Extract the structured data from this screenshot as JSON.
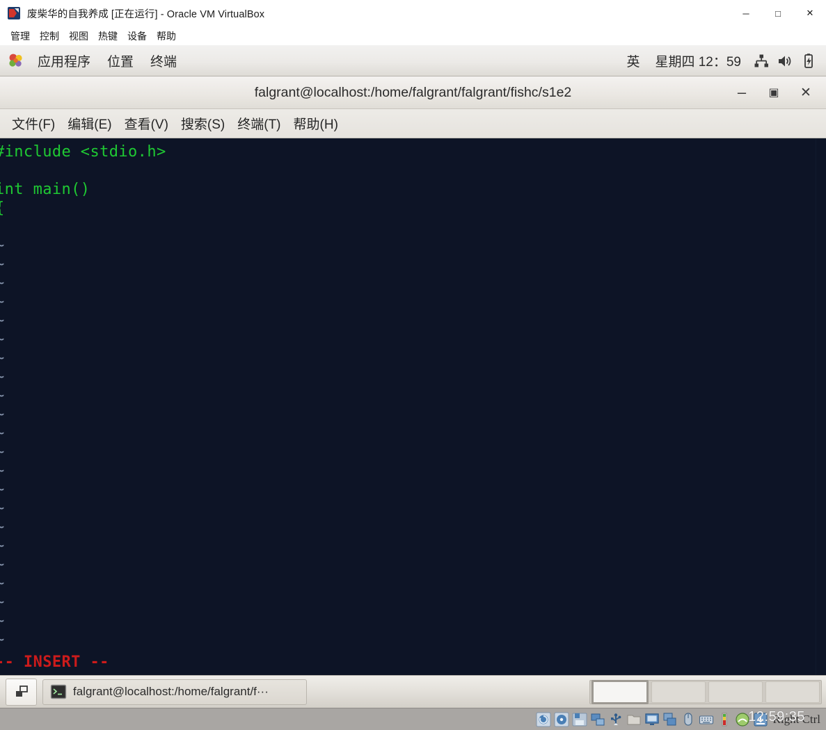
{
  "host_window": {
    "title_main": "废柴华的自我养成",
    "title_state": "[正在运行]",
    "title_suffix": "- Oracle VM VirtualBox",
    "title_full": "废柴华的自我养成 [正在运行] - Oracle VM VirtualBox",
    "controls": {
      "minimize": "─",
      "maximize": "□",
      "close": "✕"
    }
  },
  "vbox_menu": {
    "items": [
      {
        "label": "管理"
      },
      {
        "label": "控制"
      },
      {
        "label": "视图"
      },
      {
        "label": "热键"
      },
      {
        "label": "设备"
      },
      {
        "label": "帮助"
      }
    ]
  },
  "gnome_panel": {
    "menus": [
      {
        "label": "应用程序",
        "icon": "gnome-foot-icon"
      },
      {
        "label": "位置"
      },
      {
        "label": "终端"
      }
    ],
    "input_method": "英",
    "clock": "星期四 12：59",
    "tray": [
      {
        "icon": "network-icon",
        "name": "network-applet"
      },
      {
        "icon": "volume-icon",
        "name": "volume-applet"
      },
      {
        "icon": "battery-icon",
        "name": "battery-applet"
      }
    ]
  },
  "terminal": {
    "title": "falgrant@localhost:/home/falgrant/falgrant/fishc/s1e2",
    "controls": {
      "minimize": "–",
      "maximize": "▣",
      "close": "✕"
    },
    "menu": [
      {
        "label": "文件(F)"
      },
      {
        "label": "编辑(E)"
      },
      {
        "label": "查看(V)"
      },
      {
        "label": "搜索(S)"
      },
      {
        "label": "终端(T)"
      },
      {
        "label": "帮助(H)"
      }
    ],
    "colors": {
      "background": "#0d1426",
      "foreground_code": "#1fc933",
      "tilde": "#8896ae",
      "status": "#cc1b1b"
    },
    "vim": {
      "lines": [
        {
          "text": "#include <stdio.h>",
          "type": "code"
        },
        {
          "text": "",
          "type": "blank"
        },
        {
          "text": "int main()",
          "type": "code"
        },
        {
          "text": "{",
          "type": "code"
        },
        {
          "text": "",
          "type": "blank"
        }
      ],
      "tilde_char": "~",
      "tilde_count": 22,
      "status_line": "-- INSERT --"
    }
  },
  "gnome_taskbar": {
    "show_desktop_label": "show-desktop",
    "windows": [
      {
        "label": "falgrant@localhost:/home/falgrant/f···",
        "icon": "terminal-icon"
      }
    ],
    "workspaces": [
      {
        "index": 1,
        "active": true
      },
      {
        "index": 2,
        "active": false
      },
      {
        "index": 3,
        "active": false
      },
      {
        "index": 4,
        "active": false
      }
    ]
  },
  "vbox_statusbar": {
    "host_key": "Right Ctrl",
    "clock_overlay": "12:59:35",
    "devices": [
      {
        "name": "hard-disk-icon"
      },
      {
        "name": "optical-disk-icon"
      },
      {
        "name": "floppy-icon"
      },
      {
        "name": "network-icon"
      },
      {
        "name": "usb-icon"
      },
      {
        "name": "shared-folder-icon"
      },
      {
        "name": "display-icon"
      },
      {
        "name": "video-capture-icon"
      },
      {
        "name": "mouse-icon"
      },
      {
        "name": "keyboard-icon"
      },
      {
        "name": "performance-icon"
      },
      {
        "name": "guest-additions-icon"
      },
      {
        "name": "host-drive-icon"
      }
    ]
  }
}
